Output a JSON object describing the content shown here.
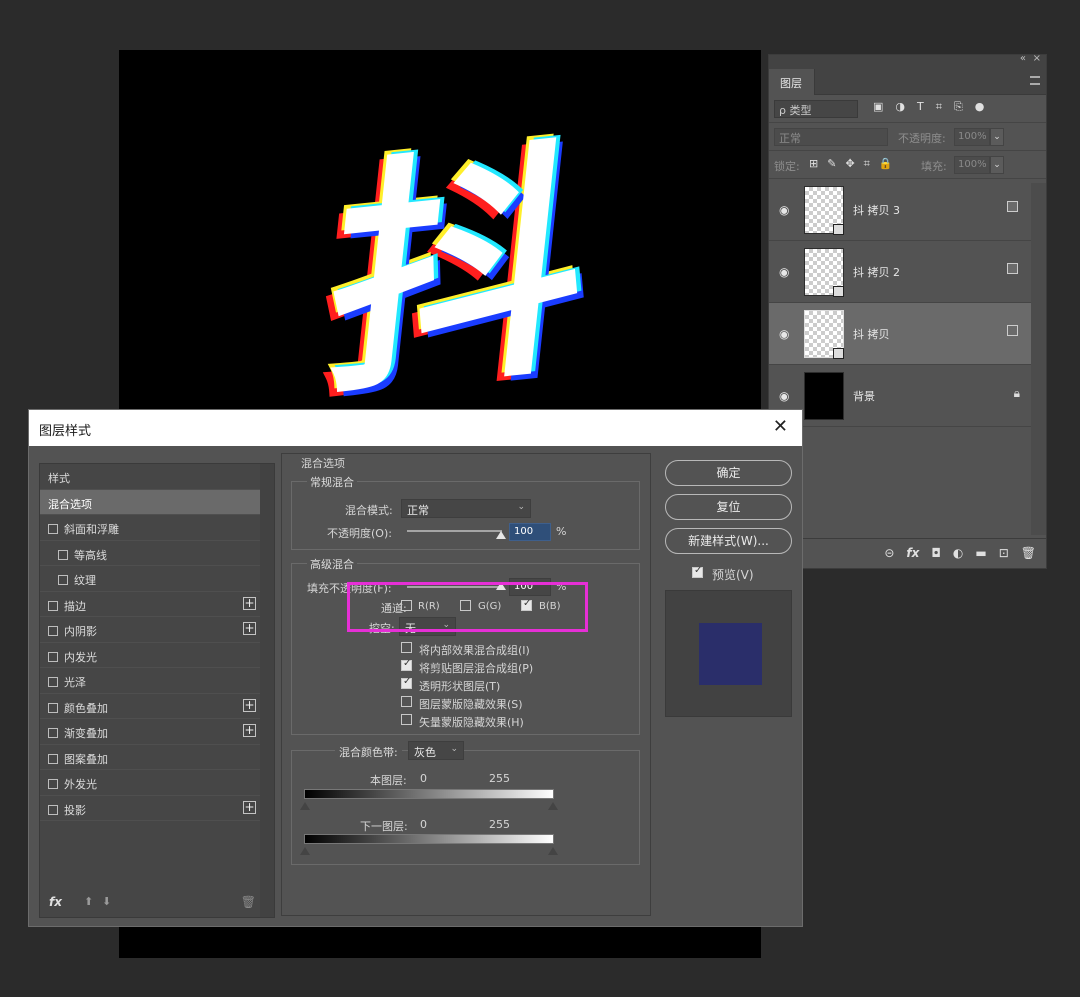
{
  "canvas": {
    "glyph": "抖"
  },
  "layers_panel": {
    "collapse_icon": "«",
    "close_icon": "×",
    "tab": "图层",
    "filter_kind": "ρ 类型",
    "filter_tools": [
      "▣",
      "◑",
      "T",
      "⌗",
      "⎘",
      "●"
    ],
    "blend_mode": "正常",
    "opacity_label": "不透明度:",
    "opacity_value": "100%",
    "lock_label": "锁定:",
    "lock_icons": [
      "⊞",
      "✎",
      "✥",
      "⌗",
      "🔒"
    ],
    "fill_label": "填充:",
    "fill_value": "100%",
    "layers": [
      {
        "name": "抖 拷贝 3",
        "selected": false,
        "type": "smart"
      },
      {
        "name": "抖 拷贝 2",
        "selected": false,
        "type": "smart"
      },
      {
        "name": "抖 拷贝",
        "selected": true,
        "type": "smart"
      },
      {
        "name": "背景",
        "selected": false,
        "type": "background"
      }
    ],
    "bottom_icons": [
      "⊝",
      "fx",
      "◘",
      "◐",
      "▬",
      "⊡",
      "🗑"
    ]
  },
  "dialog": {
    "title": "图层样式",
    "close": "✕",
    "styles": {
      "header": "样式",
      "blend_options": "混合选项",
      "items": [
        {
          "label": "斜面和浮雕",
          "indent": false,
          "plus": false
        },
        {
          "label": "等高线",
          "indent": true,
          "plus": false
        },
        {
          "label": "纹理",
          "indent": true,
          "plus": false
        },
        {
          "label": "描边",
          "indent": false,
          "plus": true
        },
        {
          "label": "内阴影",
          "indent": false,
          "plus": true
        },
        {
          "label": "内发光",
          "indent": false,
          "plus": false
        },
        {
          "label": "光泽",
          "indent": false,
          "plus": false
        },
        {
          "label": "颜色叠加",
          "indent": false,
          "plus": true
        },
        {
          "label": "渐变叠加",
          "indent": false,
          "plus": true
        },
        {
          "label": "图案叠加",
          "indent": false,
          "plus": false
        },
        {
          "label": "外发光",
          "indent": false,
          "plus": false
        },
        {
          "label": "投影",
          "indent": false,
          "plus": true
        }
      ],
      "footer": {
        "fx": "fx",
        "up": "⬆",
        "down": "⬇",
        "trash": "🗑"
      }
    },
    "blend": {
      "section_title": "混合选项",
      "general_title": "常规混合",
      "mode_label": "混合模式:",
      "mode_value": "正常",
      "opacity_label": "不透明度(O):",
      "opacity_value": "100",
      "opacity_level": 100,
      "percent": "%",
      "advanced_title": "高级混合",
      "fill_label": "填充不透明度(F):",
      "fill_value": "100",
      "channels_label": "通道:",
      "channel_r": "R(R)",
      "channel_g": "G(G)",
      "channel_b": "B(B)",
      "channel_r_on": false,
      "channel_g_on": false,
      "channel_b_on": true,
      "knockout_label": "挖空:",
      "knockout_value": "无",
      "options": [
        {
          "label": "将内部效果混合成组(I)",
          "checked": false
        },
        {
          "label": "将剪贴图层混合成组(P)",
          "checked": true
        },
        {
          "label": "透明形状图层(T)",
          "checked": true
        },
        {
          "label": "图层蒙版隐藏效果(S)",
          "checked": false
        },
        {
          "label": "矢量蒙版隐藏效果(H)",
          "checked": false
        }
      ],
      "band_label": "混合颜色带:",
      "band_value": "灰色",
      "this_layer_label": "本图层:",
      "this_low": "0",
      "this_high": "255",
      "under_layer_label": "下一图层:",
      "under_low": "0",
      "under_high": "255"
    },
    "buttons": {
      "ok": "确定",
      "reset": "复位",
      "new_style": "新建样式(W)...",
      "preview_label": "预览(V)",
      "preview_on": true
    }
  },
  "colors": {
    "highlight": "#e62fd6",
    "preview_swatch": "#2a2e6a"
  }
}
